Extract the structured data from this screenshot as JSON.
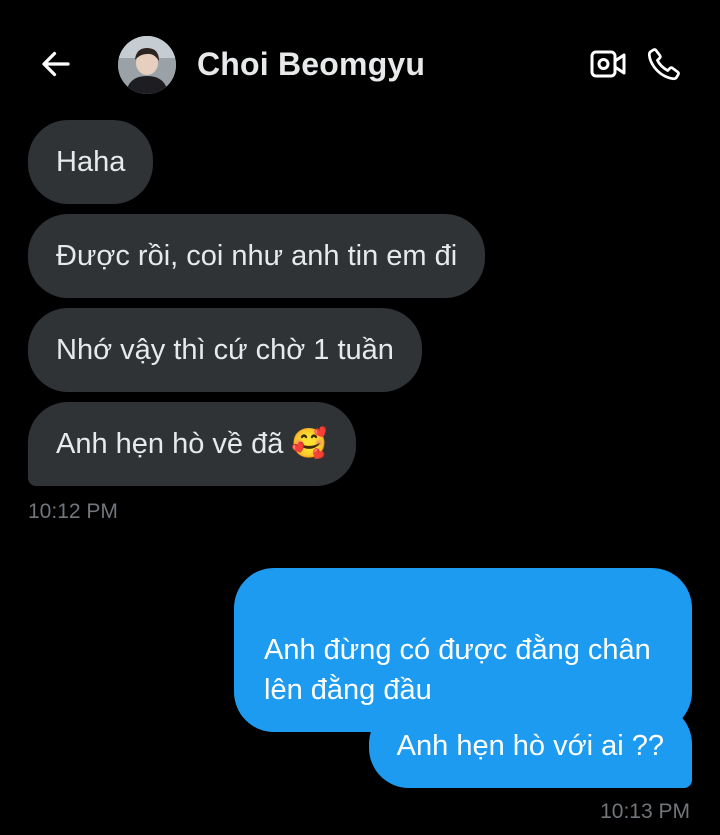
{
  "header": {
    "contact_name": "Choi Beomgyu",
    "back_icon": "arrow-left-icon",
    "video_icon": "video-call-icon",
    "call_icon": "phone-icon"
  },
  "messages": [
    {
      "direction": "incoming",
      "text": "Haha"
    },
    {
      "direction": "incoming",
      "text": "Được rồi, coi như anh tin em đi"
    },
    {
      "direction": "incoming",
      "text": "Nhớ vậy thì cứ chờ 1 tuần"
    },
    {
      "direction": "incoming",
      "text": "Anh hẹn hò về đã 🥰"
    },
    {
      "direction": "outgoing",
      "text": "Anh đừng có được đằng chân\nlên đằng đầu"
    },
    {
      "direction": "outgoing",
      "text": "Anh hẹn hò với ai ??"
    }
  ],
  "timestamps": {
    "incoming_group": "10:12 PM",
    "outgoing_group": "10:13 PM"
  },
  "colors": {
    "background": "#000000",
    "incoming_bubble": "#2f3336",
    "outgoing_bubble": "#1d9bf0",
    "timestamp": "#71767b"
  }
}
